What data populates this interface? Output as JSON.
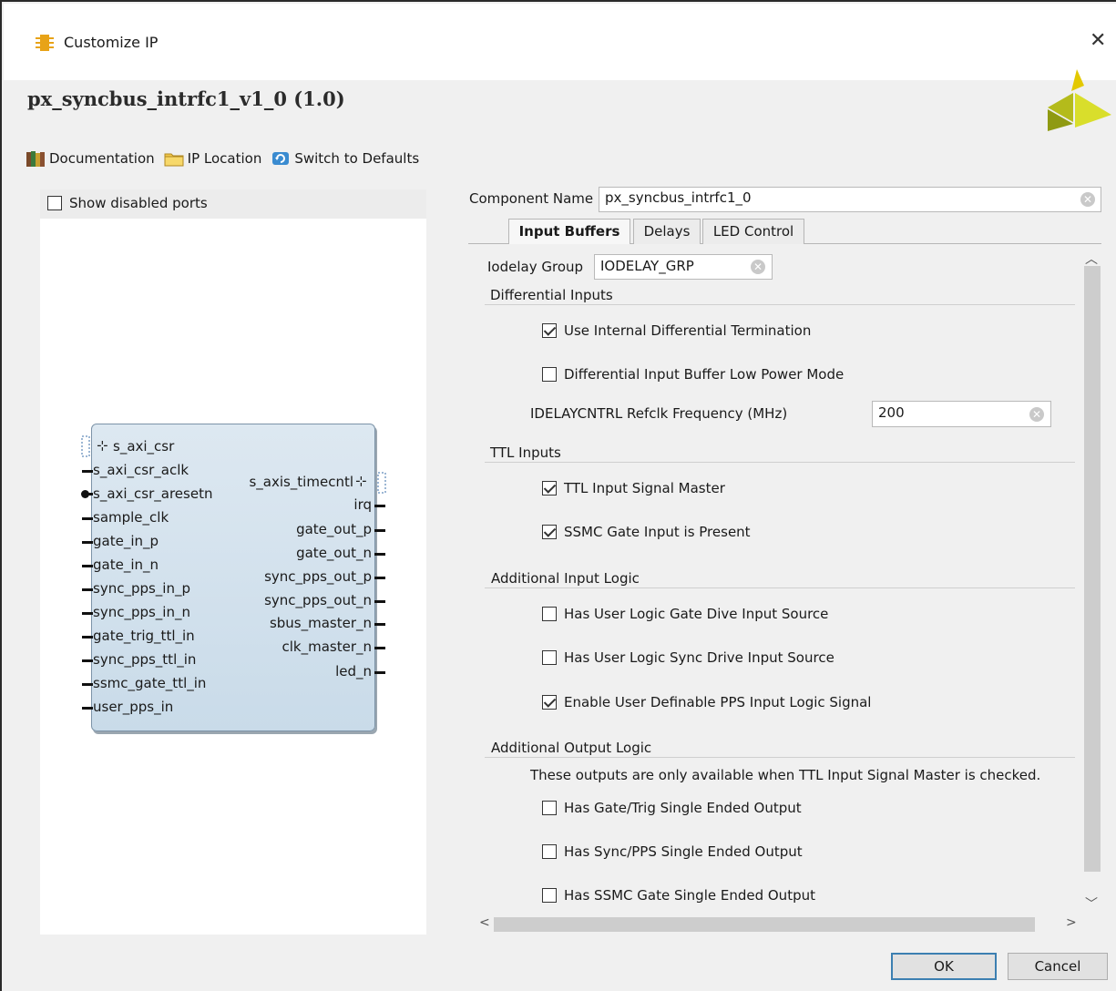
{
  "window": {
    "title": "Customize IP",
    "ip_title": "px_syncbus_intrfc1_v1_0 (1.0)"
  },
  "toolbar": {
    "documentation": "Documentation",
    "ip_location": "IP Location",
    "switch_defaults": "Switch to Defaults"
  },
  "preview": {
    "show_disabled_ports": "Show disabled ports",
    "show_disabled_checked": false,
    "left_ports": [
      "s_axi_csr",
      "s_axi_csr_aclk",
      "s_axi_csr_aresetn",
      "sample_clk",
      "gate_in_p",
      "gate_in_n",
      "sync_pps_in_p",
      "sync_pps_in_n",
      "gate_trig_ttl_in",
      "sync_pps_ttl_in",
      "ssmc_gate_ttl_in",
      "user_pps_in"
    ],
    "right_ports": [
      "s_axis_timecntl",
      "irq",
      "gate_out_p",
      "gate_out_n",
      "sync_pps_out_p",
      "sync_pps_out_n",
      "sbus_master_n",
      "clk_master_n",
      "led_n"
    ]
  },
  "component": {
    "label": "Component Name",
    "value": "px_syncbus_intrfc1_0"
  },
  "tabs": [
    "Input Buffers",
    "Delays",
    "LED Control"
  ],
  "active_tab": "Input Buffers",
  "input_buffers": {
    "iodelay_label": "Iodelay Group",
    "iodelay_value": "IODELAY_GRP",
    "diff_section": "Differential Inputs",
    "use_internal_term": "Use Internal Differential Termination",
    "use_internal_term_checked": true,
    "diff_low_power": "Differential Input Buffer Low Power Mode",
    "diff_low_power_checked": false,
    "refclk_label": "IDELAYCNTRL Refclk Frequency (MHz)",
    "refclk_value": "200",
    "ttl_section": "TTL Inputs",
    "ttl_master": "TTL Input Signal Master",
    "ttl_master_checked": true,
    "ssmc_present": "SSMC Gate Input is Present",
    "ssmc_present_checked": true,
    "add_input_section": "Additional Input Logic",
    "user_gate": "Has User Logic Gate Dive Input Source",
    "user_gate_checked": false,
    "user_sync": "Has User Logic Sync Drive Input Source",
    "user_sync_checked": false,
    "user_pps": "Enable User Definable PPS Input Logic Signal",
    "user_pps_checked": true,
    "add_output_section": "Additional Output Logic",
    "output_note": "These outputs are only available when TTL Input Signal Master is checked.",
    "gate_trig_out": "Has Gate/Trig Single Ended Output",
    "gate_trig_out_checked": false,
    "sync_pps_out": "Has Sync/PPS Single Ended Output",
    "sync_pps_out_checked": false,
    "ssmc_out": "Has SSMC Gate Single Ended Output",
    "ssmc_out_checked": false
  },
  "buttons": {
    "ok": "OK",
    "cancel": "Cancel"
  },
  "colors": {
    "block_fill": "#d3e2ee",
    "block_border": "#7c93a8",
    "default_button_border": "#3c7fb1"
  }
}
